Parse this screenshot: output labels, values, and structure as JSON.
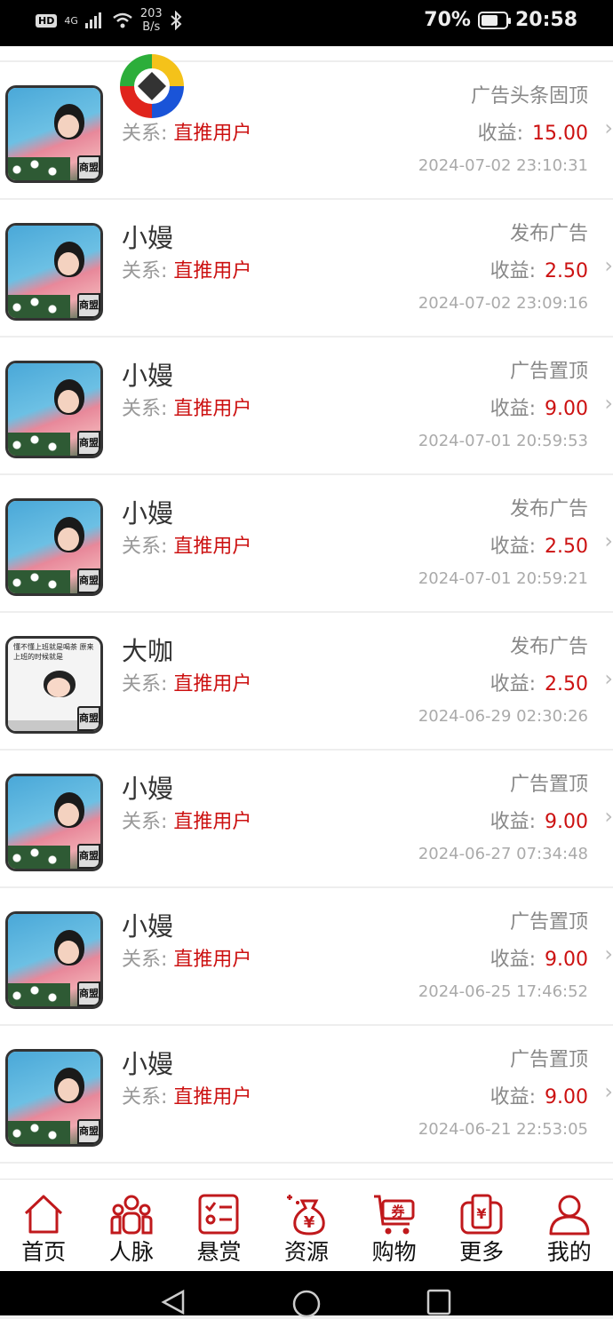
{
  "status_bar": {
    "left_hd": "HD",
    "left_net": "4G",
    "speed_value": "203",
    "speed_unit": "B/s",
    "battery": "70%",
    "battery_level": 0.7,
    "time": "20:58"
  },
  "items": [
    {
      "name": "",
      "relation_label": "关系:",
      "relation_value": "直推用户",
      "type": "广告头条固顶",
      "earn_label": "收益:",
      "earn_value": "15.00",
      "time": "2024-07-02 23:10:31",
      "avatar": "photo"
    },
    {
      "name": "小嫚",
      "relation_label": "关系:",
      "relation_value": "直推用户",
      "type": "发布广告",
      "earn_label": "收益:",
      "earn_value": "2.50",
      "time": "2024-07-02 23:09:16",
      "avatar": "photo"
    },
    {
      "name": "小嫚",
      "relation_label": "关系:",
      "relation_value": "直推用户",
      "type": "广告置顶",
      "earn_label": "收益:",
      "earn_value": "9.00",
      "time": "2024-07-01 20:59:53",
      "avatar": "photo"
    },
    {
      "name": "小嫚",
      "relation_label": "关系:",
      "relation_value": "直推用户",
      "type": "发布广告",
      "earn_label": "收益:",
      "earn_value": "2.50",
      "time": "2024-07-01 20:59:21",
      "avatar": "photo"
    },
    {
      "name": "大咖",
      "relation_label": "关系:",
      "relation_value": "直推用户",
      "type": "发布广告",
      "earn_label": "收益:",
      "earn_value": "2.50",
      "time": "2024-06-29 02:30:26",
      "avatar": "cartoon"
    },
    {
      "name": "小嫚",
      "relation_label": "关系:",
      "relation_value": "直推用户",
      "type": "广告置顶",
      "earn_label": "收益:",
      "earn_value": "9.00",
      "time": "2024-06-27 07:34:48",
      "avatar": "photo"
    },
    {
      "name": "小嫚",
      "relation_label": "关系:",
      "relation_value": "直推用户",
      "type": "广告置顶",
      "earn_label": "收益:",
      "earn_value": "9.00",
      "time": "2024-06-25 17:46:52",
      "avatar": "photo"
    },
    {
      "name": "小嫚",
      "relation_label": "关系:",
      "relation_value": "直推用户",
      "type": "广告置顶",
      "earn_label": "收益:",
      "earn_value": "9.00",
      "time": "2024-06-21 22:53:05",
      "avatar": "photo"
    }
  ],
  "avatar_badge": "商盟",
  "cartoon_caption": "懂不懂上班就是喝茶 原来上班的时候就是",
  "tabs": [
    {
      "label": "首页",
      "icon": "home-icon"
    },
    {
      "label": "人脉",
      "icon": "contacts-icon"
    },
    {
      "label": "悬赏",
      "icon": "reward-icon"
    },
    {
      "label": "资源",
      "icon": "money-bag-icon"
    },
    {
      "label": "购物",
      "icon": "cart-icon"
    },
    {
      "label": "更多",
      "icon": "wallet-icon"
    },
    {
      "label": "我的",
      "icon": "user-icon"
    }
  ],
  "colors": {
    "accent": "#cc1111",
    "tab_icon": "#c0191c",
    "muted": "#999999"
  }
}
